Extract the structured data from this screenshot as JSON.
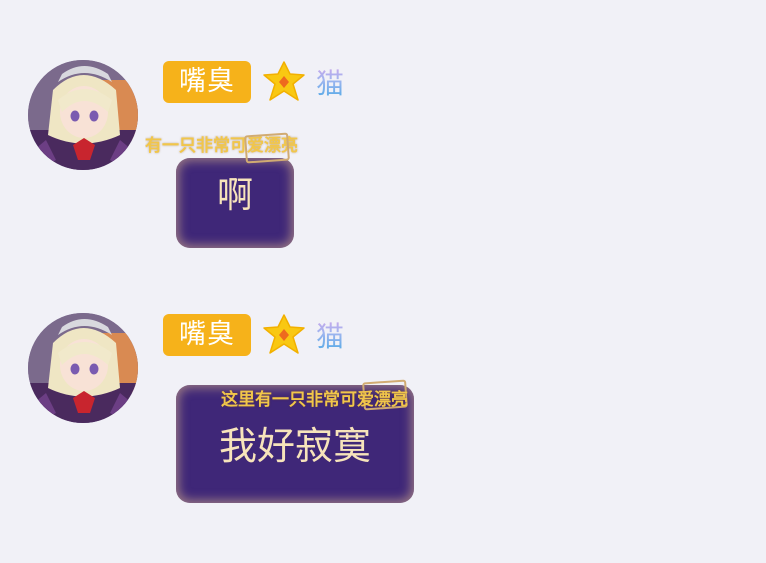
{
  "colors": {
    "background": "#f1f1f7",
    "tag_bg": "#f6b21a",
    "bubble_bg": "#3f2778",
    "bubble_text": "#f7e4bb",
    "deco_text": "#f1c64a"
  },
  "messages": [
    {
      "tag_label": "嘴臭",
      "level_icon": "star-level-icon",
      "nickname": "猫",
      "bubble_decoration": "有一只非常可爱漂亮",
      "text": "啊"
    },
    {
      "tag_label": "嘴臭",
      "level_icon": "star-level-icon",
      "nickname": "猫",
      "bubble_decoration": "这里有一只非常可爱漂亮",
      "text": "我好寂寞"
    }
  ]
}
